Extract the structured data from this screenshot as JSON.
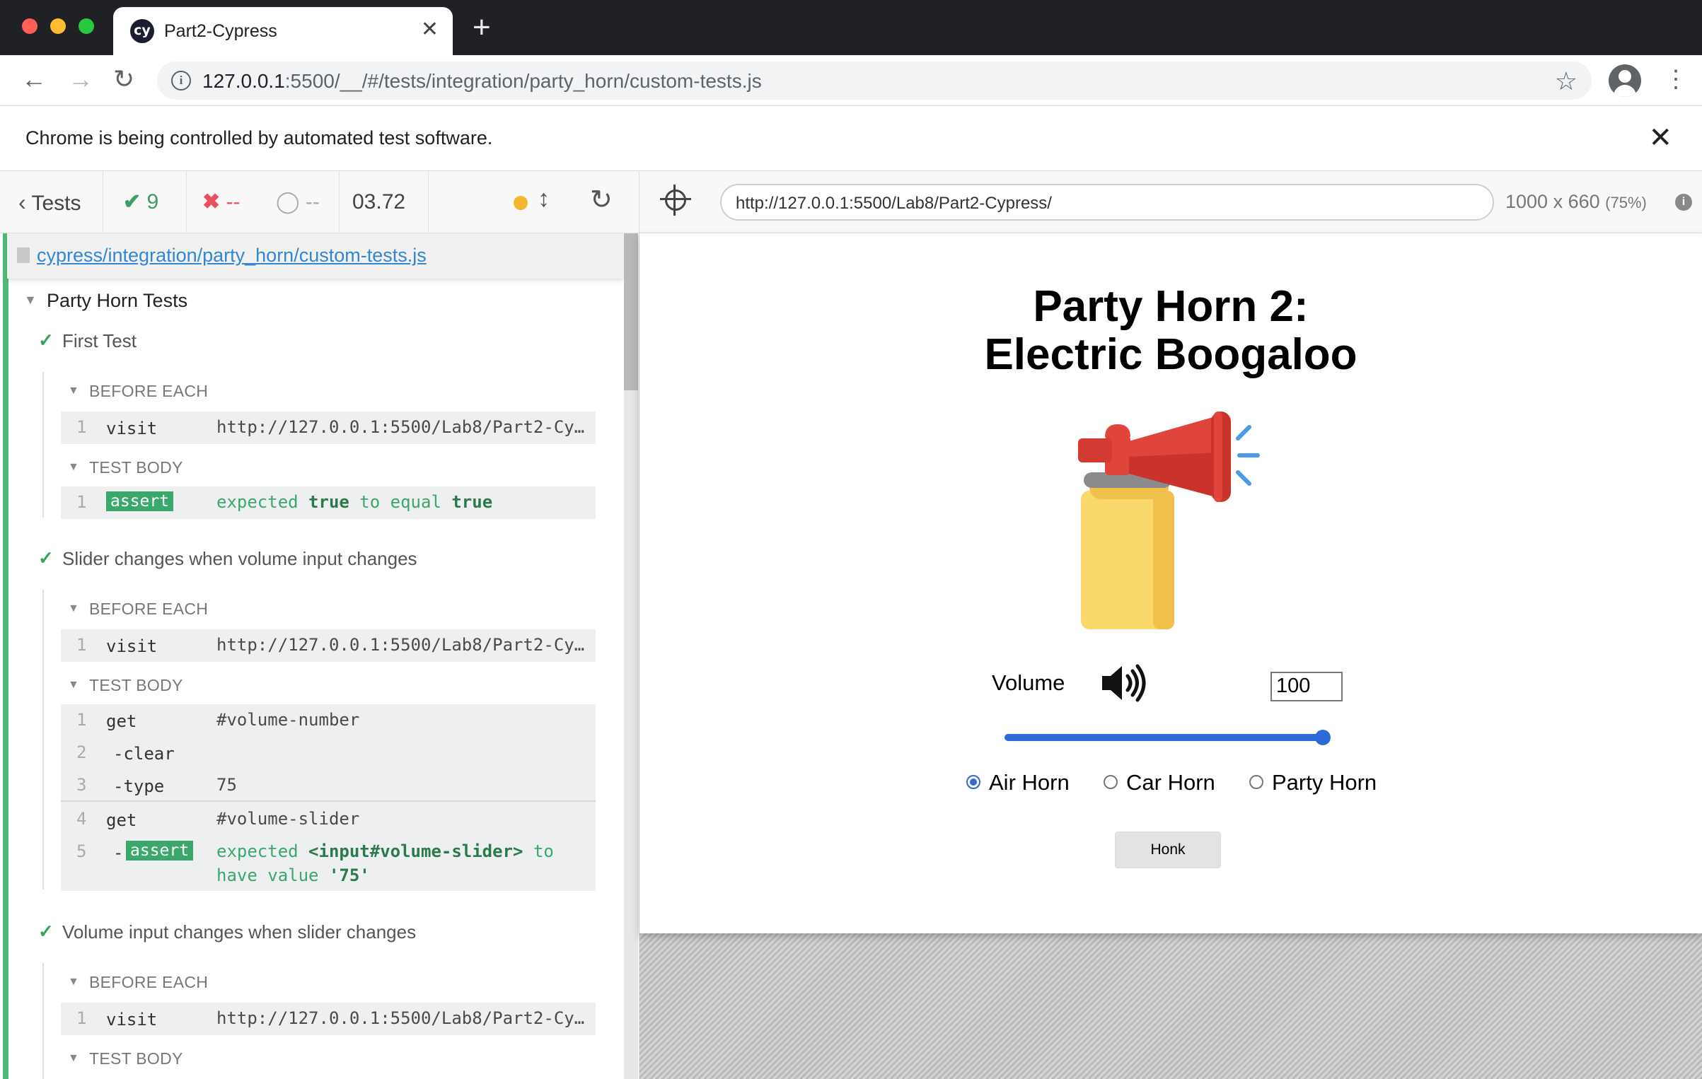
{
  "browser": {
    "tab_title": "Part2-Cypress",
    "tab_favicon": "cy",
    "url_host": "127.0.0.1",
    "url_rest": ":5500/__/#/tests/integration/party_horn/custom-tests.js",
    "infobar_text": "Chrome is being controlled by automated test software."
  },
  "reporter": {
    "back_label": "Tests",
    "passed": "9",
    "failed": "--",
    "pending": "--",
    "duration": "03.72",
    "spec_path": "cypress/integration/party_horn/custom-tests.js",
    "suite_title": "Party Horn Tests",
    "hooks": {
      "before_each": "BEFORE EACH",
      "test_body": "TEST BODY"
    },
    "tests": [
      {
        "title": "First Test",
        "before_each": [
          {
            "num": "1",
            "cmd": "visit",
            "msg": "http://127.0.0.1:5500/Lab8/Part2-Cy…"
          }
        ],
        "body_assert": {
          "num": "1",
          "badge": "assert",
          "p1": "expected",
          "v1": "true",
          "p2": "to equal",
          "v2": "true"
        }
      },
      {
        "title": "Slider changes when volume input changes",
        "before_each": [
          {
            "num": "1",
            "cmd": "visit",
            "msg": "http://127.0.0.1:5500/Lab8/Part2-Cy…"
          }
        ],
        "body": [
          {
            "num": "1",
            "cmd": "get",
            "msg": "#volume-number"
          },
          {
            "num": "2",
            "cmd": "-clear",
            "msg": ""
          },
          {
            "num": "3",
            "cmd": "-type",
            "msg": "75"
          },
          {
            "num": "4",
            "cmd": "get",
            "msg": "#volume-slider"
          }
        ],
        "body_assert": {
          "num": "5",
          "dash": "-",
          "badge": "assert",
          "p1": "expected",
          "v1": "<input#volume-slider>",
          "p2": "to",
          "p3": "have value",
          "v2": "'75'"
        }
      },
      {
        "title": "Volume input changes when slider changes",
        "before_each": [
          {
            "num": "1",
            "cmd": "visit",
            "msg": "http://127.0.0.1:5500/Lab8/Part2-Cy…"
          }
        ]
      }
    ]
  },
  "aut": {
    "url": "http://127.0.0.1:5500/Lab8/Part2-Cypress/",
    "viewport": "1000 x 660",
    "scale": "(75%)",
    "app": {
      "title_line1": "Party Horn 2:",
      "title_line2": "Electric Boogaloo",
      "volume_label": "Volume",
      "volume_value": "100",
      "volume_level": 1.0,
      "radios": [
        {
          "label": "Air Horn",
          "checked": true
        },
        {
          "label": "Car Horn",
          "checked": false
        },
        {
          "label": "Party Horn",
          "checked": false
        }
      ],
      "honk_label": "Honk"
    }
  },
  "colors": {
    "pass": "#3b9e62",
    "fail": "#e94f5f",
    "link": "#3386d4",
    "slider": "#2f6ad9"
  }
}
